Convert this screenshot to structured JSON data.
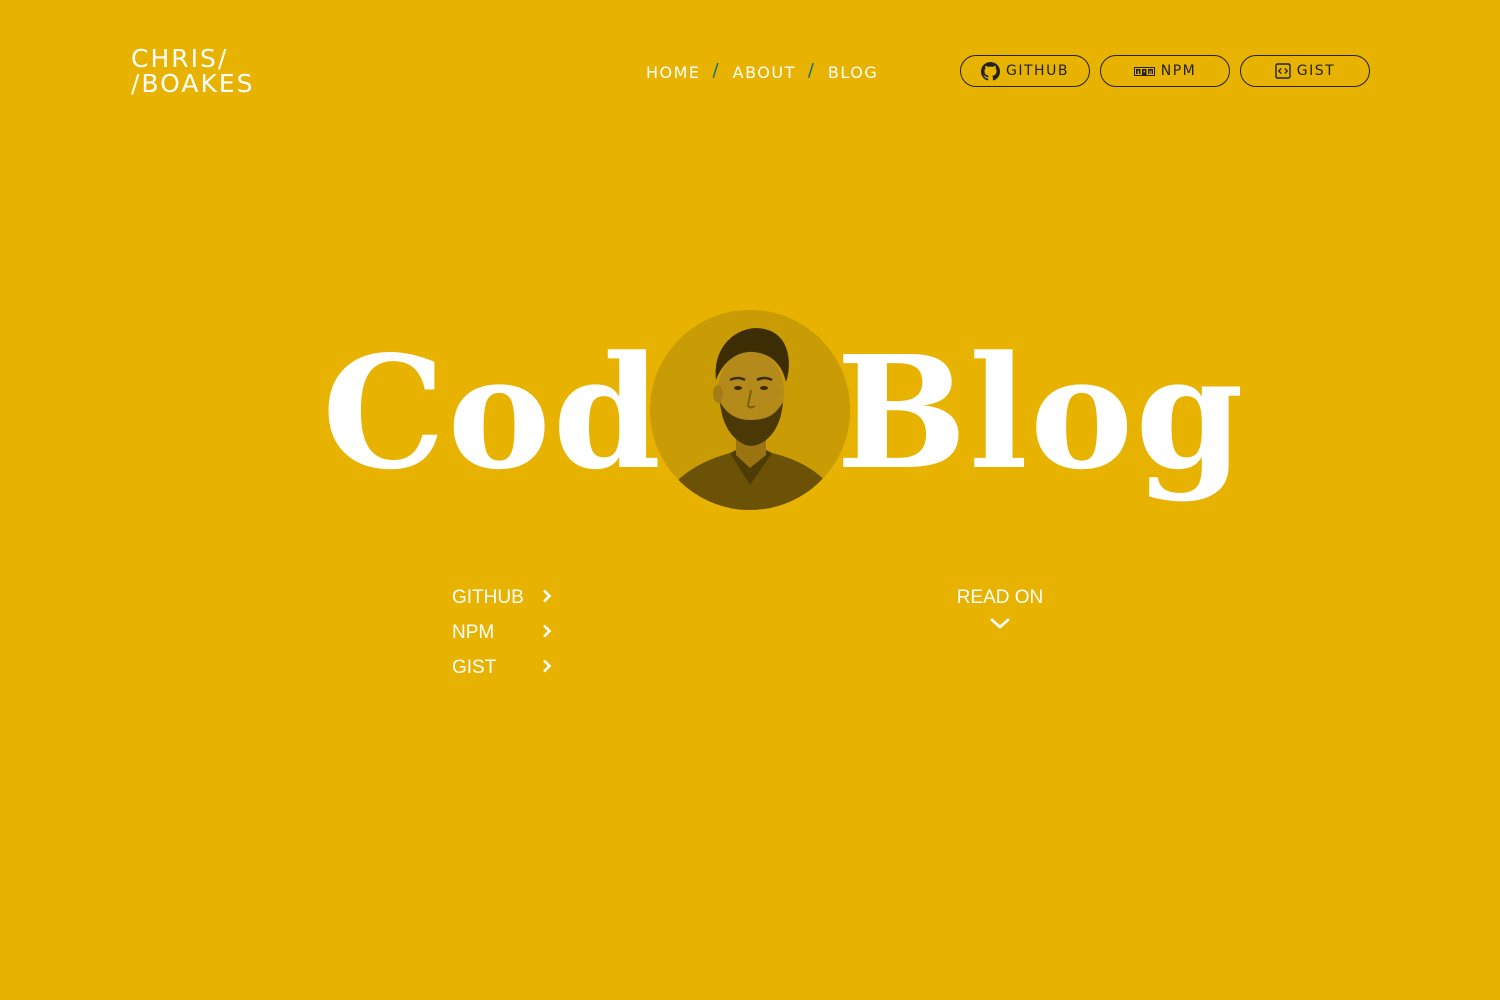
{
  "logo": {
    "line1": "CHRIS/",
    "line2": "/BOAKES"
  },
  "nav": {
    "items": [
      {
        "label": "HOME"
      },
      {
        "label": "ABOUT"
      },
      {
        "label": "BLOG"
      }
    ],
    "separator": "/"
  },
  "header_buttons": {
    "github": {
      "label": "GITHUB",
      "icon": "github-icon"
    },
    "npm": {
      "label": "NPM",
      "icon": "npm-icon"
    },
    "gist": {
      "label": "GIST",
      "icon": "code-icon"
    }
  },
  "hero": {
    "word_left": "Code",
    "word_right": "Blog",
    "avatar": "portrait-photo"
  },
  "links": [
    {
      "label": "GITHUB",
      "icon": "chevron-right-icon"
    },
    {
      "label": "NPM",
      "icon": "chevron-right-icon"
    },
    {
      "label": "GIST",
      "icon": "chevron-right-icon"
    }
  ],
  "read_on": {
    "label": "READ ON",
    "icon": "chevron-down-icon"
  },
  "colors": {
    "background": "#E8B200",
    "text": "#FFFFFF",
    "nav_separator": "#0A6F84",
    "pill_border": "#222222"
  }
}
